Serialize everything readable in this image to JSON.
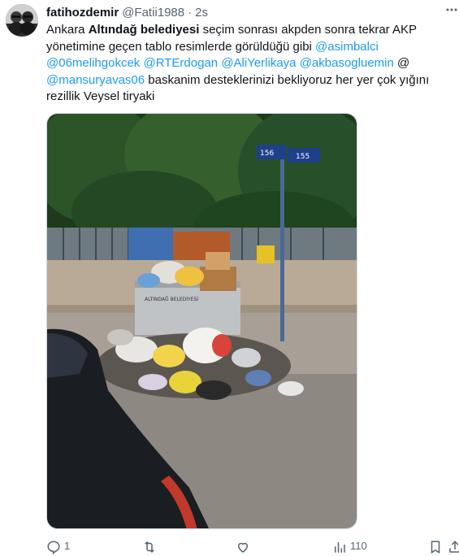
{
  "tweet": {
    "display_name": "fatihozdemir",
    "handle": "@Fatii1988",
    "separator": "·",
    "timestamp": "2s",
    "text_line1_a": "Ankara ",
    "text_line1_bold": "Altındağ belediyesi",
    "text_line1_b": " seçim sonrası akpden sonra tekrar AKP",
    "text_line2_a": "yönetimine geçen tablo resimlerde görüldüğü gibi ",
    "mention_asimbalci": "@asimbalci",
    "mention_06melihgokcek": "@06melihgokcek",
    "mention_rterdogan": "@RTErdogan",
    "mention_aliyerlikaya": "@AliYerlikaya",
    "mention_akbasogluemin": "@akbasogluemin",
    "text_at": " @",
    "mention_mansuryavas06": "@mansuryavas06",
    "text_line4_b": " baskanim desteklerinizi bekliyoruz her yer çok yığını",
    "text_line5": "rezillik Veysel tiryaki",
    "image_sign_text": "ALTINDAĞ BELEDİYESİ",
    "street_sign_left": "156",
    "street_sign_right": "155"
  },
  "actions": {
    "reply_count": "1",
    "retweet_count": "",
    "like_count": "",
    "views_count": "110"
  },
  "icons": {
    "more": "more-dots-icon",
    "reply": "reply-icon",
    "retweet": "retweet-icon",
    "like": "heart-icon",
    "views": "views-chart-icon",
    "bookmark": "bookmark-icon",
    "share": "share-icon"
  },
  "colors": {
    "mention": "#1d9bf0",
    "secondary_text": "#536471",
    "primary_text": "#0f1419"
  }
}
